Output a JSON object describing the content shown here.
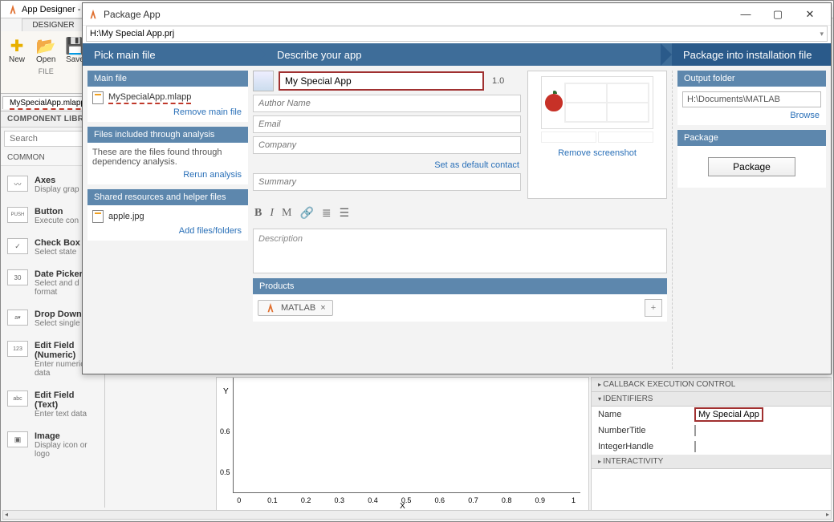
{
  "bg": {
    "title": "App Designer - ",
    "designer_tab": "DESIGNER",
    "tools": {
      "new": "New",
      "open": "Open",
      "save": "Save"
    },
    "file_label": "FILE",
    "open_file": "MySpecialApp.mlapp",
    "component_library": "COMPONENT LIBR",
    "search_placeholder": "Search",
    "common": "COMMON",
    "components": [
      {
        "title": "Axes",
        "sub": "Display grap"
      },
      {
        "title": "Button",
        "sub": "Execute con"
      },
      {
        "title": "Check Box",
        "sub": "Select state"
      },
      {
        "title": "Date Picker",
        "sub": "Select and d\nformat"
      },
      {
        "title": "Drop Down",
        "sub": "Select single"
      },
      {
        "title": "Edit Field (Numeric)",
        "sub": "Enter numeric data"
      },
      {
        "title": "Edit Field (Text)",
        "sub": "Enter text data"
      },
      {
        "title": "Image",
        "sub": "Display icon or logo"
      }
    ],
    "axis": {
      "ylabel": "Y",
      "xlabel": "X",
      "xticks": [
        "0",
        "0.1",
        "0.2",
        "0.3",
        "0.4",
        "0.5",
        "0.6",
        "0.7",
        "0.8",
        "0.9",
        "1"
      ],
      "yticks": [
        "0.5",
        "0.6"
      ]
    },
    "props": {
      "h1": "CALLBACK EXECUTION CONTROL",
      "h2": "IDENTIFIERS",
      "h3": "INTERACTIVITY",
      "name_label": "Name",
      "name_value": "My Special App",
      "numbertitle": "NumberTitle",
      "integerhandle": "IntegerHandle"
    }
  },
  "pkg": {
    "title": "Package App",
    "path": "H:\\My Special App.prj",
    "steps": {
      "s1": "Pick main file",
      "s2": "Describe your app",
      "s3": "Package into installation file"
    },
    "mainfile": {
      "header": "Main file",
      "file": "MySpecialApp.mlapp",
      "remove": "Remove main file"
    },
    "included": {
      "header": "Files included through analysis",
      "desc": "These are the files found through dependency analysis.",
      "rerun": "Rerun analysis"
    },
    "shared": {
      "header": "Shared resources and helper files",
      "file": "apple.jpg",
      "add": "Add files/folders"
    },
    "describe": {
      "name": "My Special App",
      "version": "1.0",
      "author_ph": "Author Name",
      "email_ph": "Email",
      "company_ph": "Company",
      "set_default": "Set as default contact",
      "summary_ph": "Summary",
      "desc_ph": "Description",
      "remove_shot": "Remove screenshot"
    },
    "products": {
      "header": "Products",
      "matlab": "MATLAB"
    },
    "output": {
      "header": "Output folder",
      "path": "H:\\Documents\\MATLAB",
      "browse": "Browse"
    },
    "package": {
      "header": "Package",
      "btn": "Package"
    }
  }
}
